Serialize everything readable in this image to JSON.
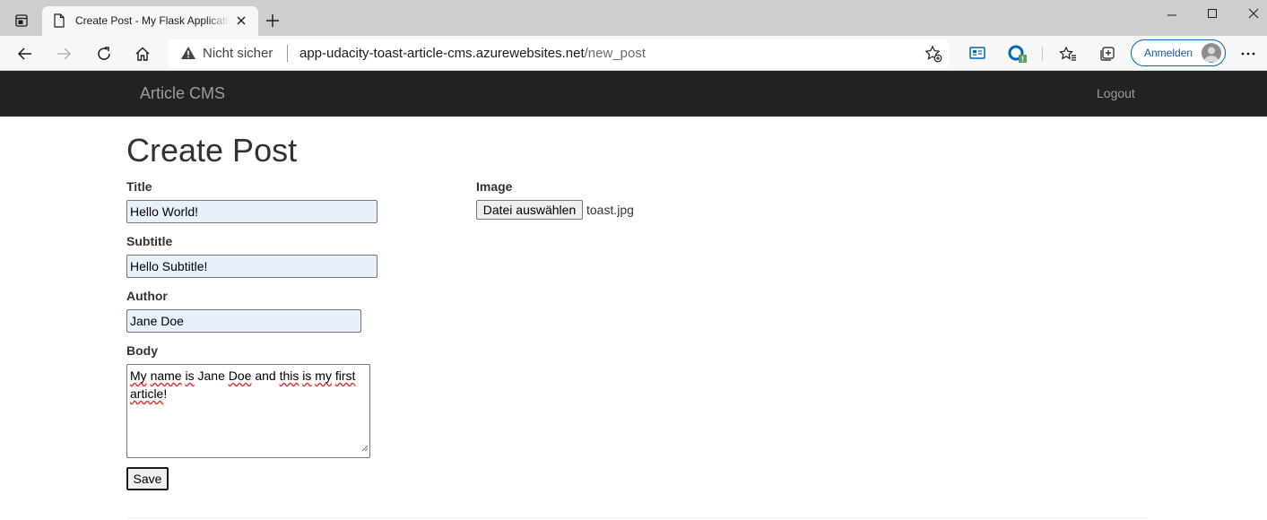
{
  "browser": {
    "tab_title": "Create Post - My Flask Application",
    "security_label": "Nicht sicher",
    "url_host": "app-udacity-toast-article-cms.azurewebsites.net",
    "url_path": "/new_post",
    "signin_label": "Anmelden",
    "accent_color": "#0067b8"
  },
  "navbar": {
    "brand": "Article CMS",
    "logout": "Logout",
    "background": "#222222"
  },
  "form": {
    "heading": "Create Post",
    "title_label": "Title",
    "title_value": "Hello World!",
    "subtitle_label": "Subtitle",
    "subtitle_value": "Hello Subtitle!",
    "author_label": "Author",
    "author_value": "Jane Doe",
    "body_label": "Body",
    "body_words": [
      "My",
      "name",
      "is",
      "Jane",
      "Doe",
      "and",
      "this",
      "is",
      "my",
      "first",
      "article",
      "!"
    ],
    "image_label": "Image",
    "file_button": "Datei auswählen",
    "file_name": "toast.jpg",
    "save_button": "Save"
  }
}
